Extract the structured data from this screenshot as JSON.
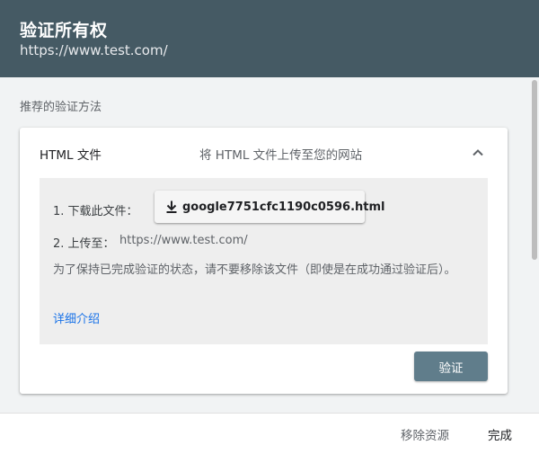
{
  "header": {
    "title": "验证所有权",
    "url": "https://www.test.com/"
  },
  "section": {
    "label": "推荐的验证方法"
  },
  "method": {
    "title": "HTML 文件",
    "description": "将 HTML 文件上传至您的网站",
    "chevron_icon": "chevron-up-icon",
    "step1_label": "1. 下载此文件：",
    "download": {
      "icon": "download-icon",
      "filename": "google7751cfc1190c0596.html"
    },
    "step2_label": "2. 上传至：",
    "step2_url": "https://www.test.com/",
    "note": "为了保持已完成验证的状态，请不要移除该文件（即使是在成功通过验证后）。",
    "learn_more": "详细介绍",
    "verify_label": "验证"
  },
  "footer": {
    "remove_label": "移除资源",
    "done_label": "完成"
  },
  "colors": {
    "header_bg": "#455a64",
    "verify_bg": "#607d8b",
    "link": "#1a73e8",
    "panel_bg": "#eeeeee"
  }
}
